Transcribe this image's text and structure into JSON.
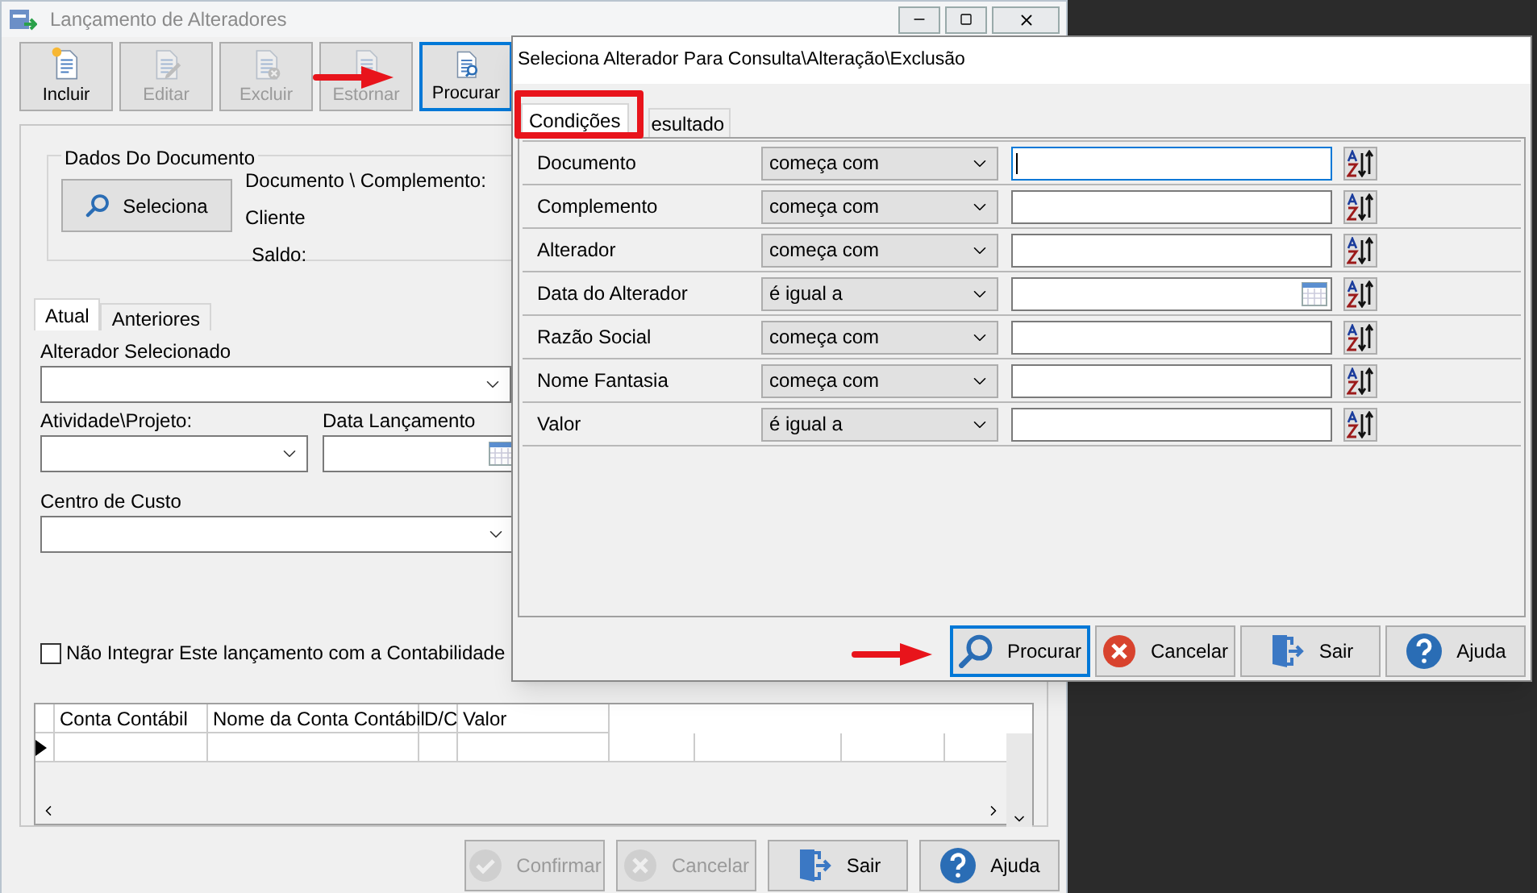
{
  "main_window": {
    "title": "Lançamento de Alteradores",
    "toolbar": [
      {
        "kind": "new",
        "label": "Incluir",
        "disabled": false,
        "focused": false
      },
      {
        "kind": "edit",
        "label": "Editar",
        "disabled": true,
        "focused": false
      },
      {
        "kind": "delete",
        "label": "Excluir",
        "disabled": true,
        "focused": false
      },
      {
        "kind": "reverse",
        "label": "Estornar",
        "disabled": true,
        "focused": false
      },
      {
        "kind": "search",
        "label": "Procurar",
        "disabled": false,
        "focused": true
      }
    ],
    "document_group": {
      "title": "Dados Do Documento",
      "select_button": "Seleciona",
      "labels": [
        "Documento \\ Complemento:",
        "Cliente",
        "Saldo:"
      ]
    },
    "tabs": [
      {
        "label": "Atual",
        "selected": true
      },
      {
        "label": "Anteriores",
        "selected": false
      }
    ],
    "fields": {
      "alterador": {
        "label": "Alterador Selecionado"
      },
      "atividade": {
        "label": "Atividade\\Projeto:"
      },
      "data": {
        "label": "Data Lançamento"
      },
      "centro": {
        "label": "Centro de Custo"
      }
    },
    "checkbox": {
      "label": "Não Integrar Este lançamento com a Contabilidade",
      "checked": false
    },
    "grid": {
      "columns": [
        "Conta Contábil",
        "Nome da Conta Contábil",
        "D/C",
        "Valor"
      ]
    },
    "buttons": [
      {
        "kind": "confirm",
        "label": "Confirmar",
        "disabled": true
      },
      {
        "kind": "cancel",
        "label": "Cancelar",
        "disabled": true
      },
      {
        "kind": "exit",
        "label": "Sair",
        "disabled": false
      },
      {
        "kind": "help",
        "label": "Ajuda",
        "disabled": false
      }
    ]
  },
  "dialog": {
    "title": "Seleciona Alterador Para Consulta\\Alteração\\Exclusão",
    "tabs": [
      {
        "label": "Condições",
        "selected": true
      },
      {
        "label": "esultado",
        "selected": false
      }
    ],
    "conditions": [
      {
        "field": "Documento",
        "operator": "começa com",
        "kind": "text",
        "focused": true
      },
      {
        "field": "Complemento",
        "operator": "começa com",
        "kind": "text",
        "focused": false
      },
      {
        "field": "Alterador",
        "operator": "começa com",
        "kind": "text",
        "focused": false
      },
      {
        "field": "Data do Alterador",
        "operator": "é igual a",
        "kind": "date",
        "focused": false
      },
      {
        "field": "Razão Social",
        "operator": "começa com",
        "kind": "text",
        "focused": false
      },
      {
        "field": "Nome Fantasia",
        "operator": "começa com",
        "kind": "text",
        "focused": false
      },
      {
        "field": "Valor",
        "operator": "é igual a",
        "kind": "text",
        "focused": false
      }
    ],
    "buttons": [
      {
        "kind": "search",
        "label": "Procurar",
        "disabled": false,
        "focused": true
      },
      {
        "kind": "cancel",
        "label": "Cancelar",
        "disabled": false,
        "focused": false
      },
      {
        "kind": "exit",
        "label": "Sair",
        "disabled": false,
        "focused": false
      },
      {
        "kind": "help",
        "label": "Ajuda",
        "disabled": false,
        "focused": false
      }
    ]
  }
}
